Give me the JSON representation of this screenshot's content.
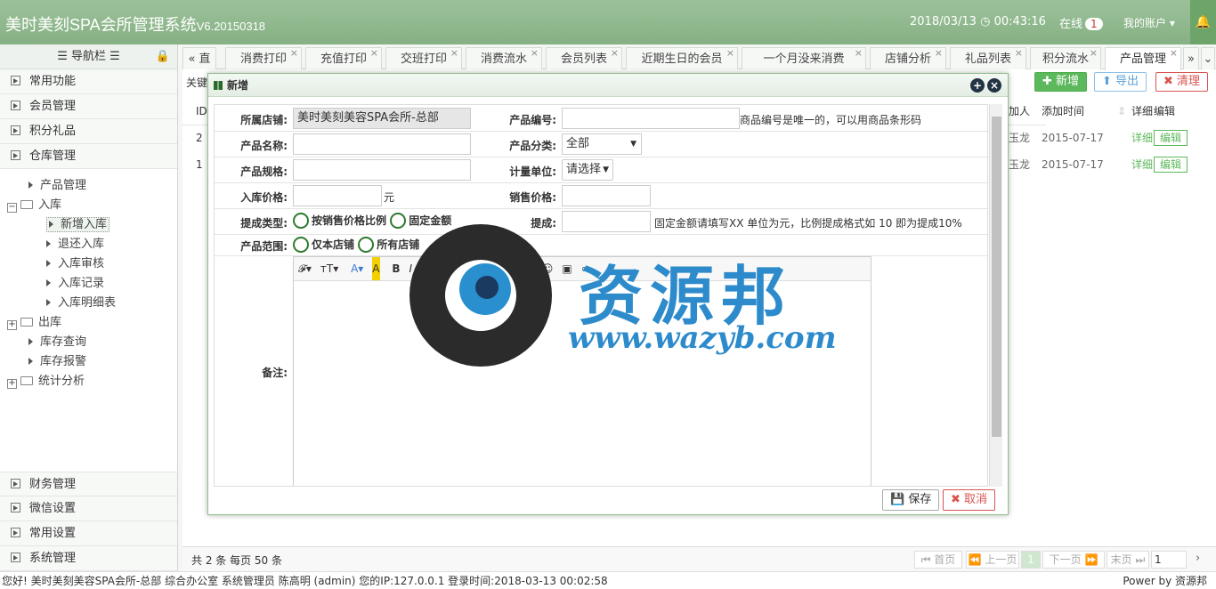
{
  "app": {
    "title": "美时美刻SPA会所管理系统",
    "version": "V6.20150318",
    "datetime": "2018/03/13",
    "time": "00:43:16",
    "online_label": "在线",
    "online_count": "1",
    "account": "我的账户"
  },
  "nav": {
    "title": "导航栏",
    "top_items": [
      "常用功能",
      "会员管理",
      "积分礼品",
      "仓库管理"
    ],
    "tree": [
      {
        "label": "产品管理",
        "level": 1
      },
      {
        "label": "入库",
        "level": 0
      },
      {
        "label": "新增入库",
        "level": 2
      },
      {
        "label": "退还入库",
        "level": 2
      },
      {
        "label": "入库审核",
        "level": 2
      },
      {
        "label": "入库记录",
        "level": 2
      },
      {
        "label": "入库明细表",
        "level": 2
      },
      {
        "label": "出库",
        "level": 0
      },
      {
        "label": "库存查询",
        "level": 1
      },
      {
        "label": "库存报警",
        "level": 1
      },
      {
        "label": "统计分析",
        "level": 0
      }
    ],
    "bottom_items": [
      "财务管理",
      "微信设置",
      "常用设置",
      "系统管理"
    ]
  },
  "tabs": [
    "消费打印",
    "充值打印",
    "交班打印",
    "消费流水",
    "会员列表",
    "近期生日的会员",
    "一个月没来消费",
    "店铺分析",
    "礼品列表",
    "积分流水",
    "产品管理"
  ],
  "tabs_prefix": "直",
  "toolbar": {
    "keyword": "关键",
    "add": "新增",
    "export": "导出",
    "clear": "清理"
  },
  "grid": {
    "headers": [
      "ID",
      "加人",
      "添加时间",
      "详细",
      "编辑"
    ],
    "rows": [
      {
        "id": "2",
        "who": "玉龙",
        "date": "2015-07-17",
        "detail": "详细",
        "edit": "编辑"
      },
      {
        "id": "1",
        "who": "玉龙",
        "date": "2015-07-17",
        "detail": "详细",
        "edit": "编辑"
      }
    ]
  },
  "pager": {
    "summary": "共 2 条 每页 50 条",
    "first": "首页",
    "prev": "上一页",
    "page": "1",
    "next": "下一页",
    "last": "末页",
    "goto": "1"
  },
  "dialog": {
    "title": "新增",
    "labels": {
      "store": "所属店铺:",
      "code": "产品编号:",
      "name": "产品名称:",
      "category": "产品分类:",
      "spec": "产品规格:",
      "unit": "计量单位:",
      "in_price": "入库价格:",
      "sale_price": "销售价格:",
      "commission_type": "提成类型:",
      "commission": "提成:",
      "scope": "产品范围:",
      "remark": "备注:"
    },
    "values": {
      "store": "美时美刻美容SPA会所-总部",
      "category": "全部",
      "unit": "请选择"
    },
    "hints": {
      "code": "商品编号是唯一的，可以用商品条形码",
      "yuan": "元",
      "commission": "固定金额请填写XX 单位为元，比例提成格式如 10 即为提成10%"
    },
    "radios": {
      "ratio": "按销售价格比例",
      "fixed": "固定金额",
      "only_store": "仅本店铺",
      "all_store": "所有店铺"
    },
    "buttons": {
      "save": "保存",
      "cancel": "取消"
    }
  },
  "watermark": {
    "cn": "资源邦",
    "url": "www.wazyb.com"
  },
  "footer": {
    "text": "您好! 美时美刻美容SPA会所-总部 综合办公室 系统管理员 陈高明 (admin) 您的IP:127.0.0.1 登录时间:2018-03-13 00:02:58",
    "power": "Power by 资源邦"
  },
  "colors": {
    "header": "#8fb88d",
    "accent_green": "#5cb85c",
    "danger": "#d9534f"
  }
}
